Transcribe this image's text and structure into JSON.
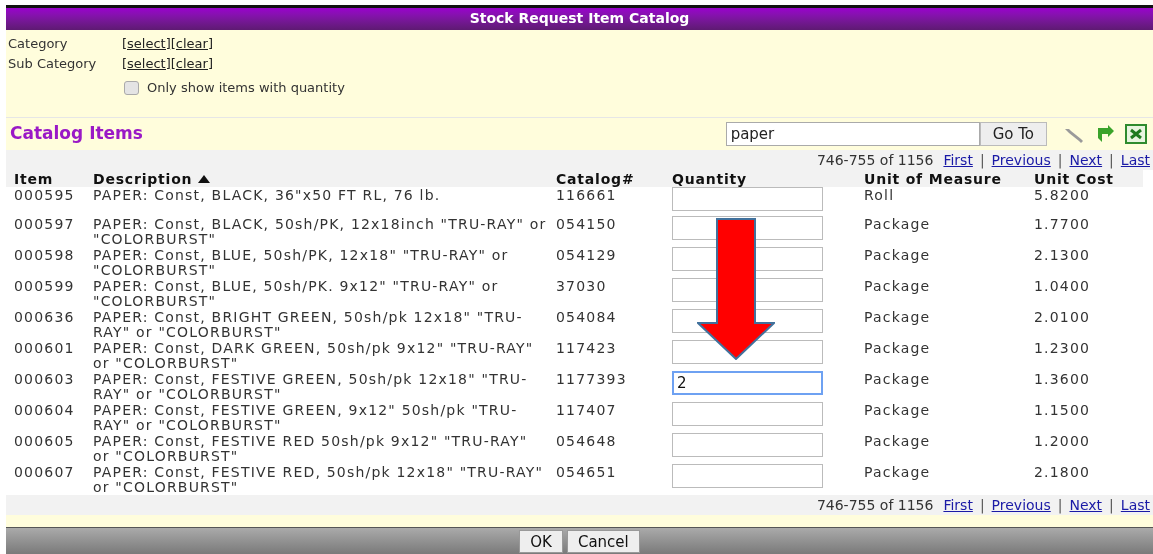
{
  "window": {
    "title": "Stock Request Item Catalog"
  },
  "filters": [
    {
      "label": "Category",
      "links": [
        "[select]",
        "[clear]"
      ]
    },
    {
      "label": "Sub Category",
      "links": [
        "[select]",
        "[clear]"
      ]
    }
  ],
  "only_with_quantity": {
    "label": "Only show items with quantity",
    "checked": false
  },
  "catalog": {
    "heading": "Catalog Items",
    "search": {
      "value": "paper"
    },
    "go_button": "Go To"
  },
  "pager_top": {
    "range": "746-755 of 1156",
    "separator": "|",
    "links": [
      "First",
      "Previous",
      "Next",
      "Last"
    ]
  },
  "table": {
    "columns": [
      {
        "label": "Item",
        "sorted": false
      },
      {
        "label": "Description",
        "sorted": true
      },
      {
        "label": "Catalog#",
        "sorted": false
      },
      {
        "label": "Quantity",
        "sorted": false
      },
      {
        "label": "Unit of Measure",
        "sorted": false
      },
      {
        "label": "Unit Cost",
        "sorted": false
      }
    ],
    "rows": [
      {
        "item": "000595",
        "description": "PAPER: Const, BLACK, 36\"x50 FT RL, 76 lb.",
        "catalog": "116661",
        "quantity": "",
        "focused": false,
        "unit": "Roll",
        "cost": "5.8200"
      },
      {
        "item": "000597",
        "description": "PAPER: Const, BLACK, 50sh/PK, 12x18inch \"TRU-RAY\" or \"COLORBURST\"",
        "catalog": "054150",
        "quantity": "",
        "focused": false,
        "unit": "Package",
        "cost": "1.7700"
      },
      {
        "item": "000598",
        "description": "PAPER: Const, BLUE, 50sh/PK, 12x18\" \"TRU-RAY\" or \"COLORBURST\"",
        "catalog": "054129",
        "quantity": "",
        "focused": false,
        "unit": "Package",
        "cost": "2.1300"
      },
      {
        "item": "000599",
        "description": "PAPER: Const, BLUE, 50sh/PK. 9x12\" \"TRU-RAY\" or \"COLORBURST\"",
        "catalog": "37030",
        "quantity": "",
        "focused": false,
        "unit": "Package",
        "cost": "1.0400"
      },
      {
        "item": "000636",
        "description": "PAPER: Const, BRIGHT GREEN, 50sh/pk 12x18\" \"TRU-RAY\" or \"COLORBURST\"",
        "catalog": "054084",
        "quantity": "",
        "focused": false,
        "unit": "Package",
        "cost": "2.0100"
      },
      {
        "item": "000601",
        "description": "PAPER: Const, DARK GREEN, 50sh/pk 9x12\" \"TRU-RAY\" or \"COLORBURST\"",
        "catalog": "117423",
        "quantity": "",
        "focused": false,
        "unit": "Package",
        "cost": "1.2300"
      },
      {
        "item": "000603",
        "description": "PAPER: Const, FESTIVE GREEN, 50sh/pk 12x18\" \"TRU-RAY\" or \"COLORBURST\"",
        "catalog": "1177393",
        "quantity": "2",
        "focused": true,
        "unit": "Package",
        "cost": "1.3600"
      },
      {
        "item": "000604",
        "description": "PAPER: Const, FESTIVE GREEN, 9x12\" 50sh/pk \"TRU-RAY\" or \"COLORBURST\"",
        "catalog": "117407",
        "quantity": "",
        "focused": false,
        "unit": "Package",
        "cost": "1.1500"
      },
      {
        "item": "000605",
        "description": "PAPER: Const, FESTIVE RED 50sh/pk 9x12\" \"TRU-RAY\" or \"COLORBURST\"",
        "catalog": "054648",
        "quantity": "",
        "focused": false,
        "unit": "Package",
        "cost": "1.2000"
      },
      {
        "item": "000607",
        "description": "PAPER: Const, FESTIVE RED, 50sh/pk 12x18\" \"TRU-RAY\" or \"COLORBURST\"",
        "catalog": "054651",
        "quantity": "",
        "focused": false,
        "unit": "Package",
        "cost": "2.1800"
      }
    ]
  },
  "pager_bottom": {
    "range": "746-755 of 1156",
    "separator": "|",
    "links": [
      "First",
      "Previous",
      "Next",
      "Last"
    ]
  },
  "buttons": [
    "OK",
    "Cancel"
  ]
}
